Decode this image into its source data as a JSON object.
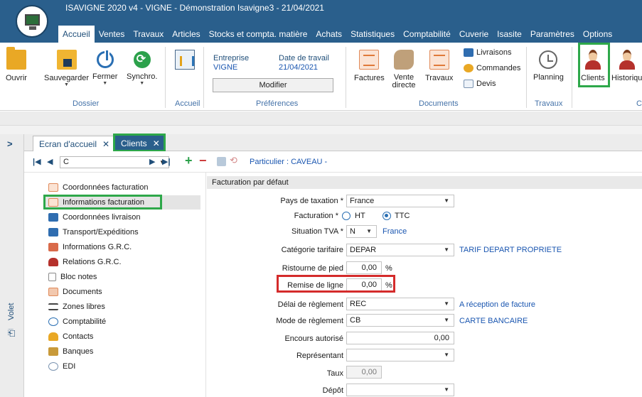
{
  "window": {
    "title": "ISAVIGNE 2020 v4 - VIGNE - Démonstration Isavigne3 - 21/04/2021"
  },
  "menu": {
    "tabs": [
      "Accueil",
      "Ventes",
      "Travaux",
      "Articles",
      "Stocks et compta. matière",
      "Achats",
      "Statistiques",
      "Comptabilité",
      "Cuverie",
      "Isasite",
      "Paramètres",
      "Options"
    ],
    "active": "Accueil"
  },
  "ribbon": {
    "dossier": {
      "label": "Dossier",
      "ouvrir": "Ouvrir",
      "sauvegarder": "Sauvegarder",
      "fermer": "Fermer",
      "synchro": "Synchro."
    },
    "accueil": {
      "label": "Accueil"
    },
    "preferences": {
      "label": "Préférences",
      "entreprise_label": "Entreprise",
      "entreprise_value": "VIGNE",
      "date_label": "Date de travail",
      "date_value": "21/04/2021",
      "modifier": "Modifier"
    },
    "documents": {
      "label": "Documents",
      "factures": "Factures",
      "vente_directe": "Vente directe",
      "travaux": "Travaux",
      "livraisons": "Livraisons",
      "commandes": "Commandes",
      "devis": "Devis"
    },
    "travaux_group": {
      "label": "Travaux",
      "planning": "Planning"
    },
    "clients_group": {
      "label": "C",
      "clients": "Clients",
      "historique": "Historiqu"
    }
  },
  "volet": {
    "label": "Volet",
    "arrow": ">"
  },
  "doc_tabs": {
    "ecran": "Ecran d'accueil",
    "clients": "Clients",
    "close": "✕"
  },
  "toolbar": {
    "record": "C",
    "particulier": "Particulier :  CAVEAU -"
  },
  "nav": {
    "items": [
      "Coordonnées facturation",
      "Informations facturation",
      "Coordonnées livraison",
      "Transport/Expéditions",
      "Informations G.R.C.",
      "Relations G.R.C.",
      "Bloc notes",
      "Documents",
      "Zones libres",
      "Comptabilité",
      "Contacts",
      "Banques",
      "EDI"
    ],
    "selected": "Informations facturation"
  },
  "form": {
    "header": "Facturation par défaut",
    "pays_label": "Pays de taxation *",
    "pays_value": "France",
    "facturation_label": "Facturation *",
    "ht": "HT",
    "ttc": "TTC",
    "facturation_value": "TTC",
    "tva_label": "Situation TVA *",
    "tva_value": "N",
    "tva_link": "France",
    "categorie_label": "Catégorie tarifaire",
    "categorie_value": "DEPAR",
    "categorie_link": "TARIF DEPART PROPRIETE",
    "ristourne_label": "Ristourne de pied",
    "ristourne_value": "0,00",
    "remise_label": "Remise de ligne",
    "remise_value": "0,00",
    "percent": "%",
    "delai_label": "Délai de règlement",
    "delai_value": "REC",
    "delai_link": "A réception de facture",
    "mode_label": "Mode de règlement",
    "mode_value": "CB",
    "mode_link": "CARTE BANCAIRE",
    "encours_label": "Encours autorisé",
    "encours_value": "0,00",
    "representant_label": "Représentant",
    "representant_value": "",
    "taux_label": "Taux",
    "taux_value": "0,00",
    "depot_label": "Dépôt",
    "depot_value": ""
  },
  "colors": {
    "title_bar": "#2a5f8c",
    "highlight_green": "#2ea84a",
    "highlight_red": "#d42b2b",
    "link_blue": "#1a56b0"
  }
}
